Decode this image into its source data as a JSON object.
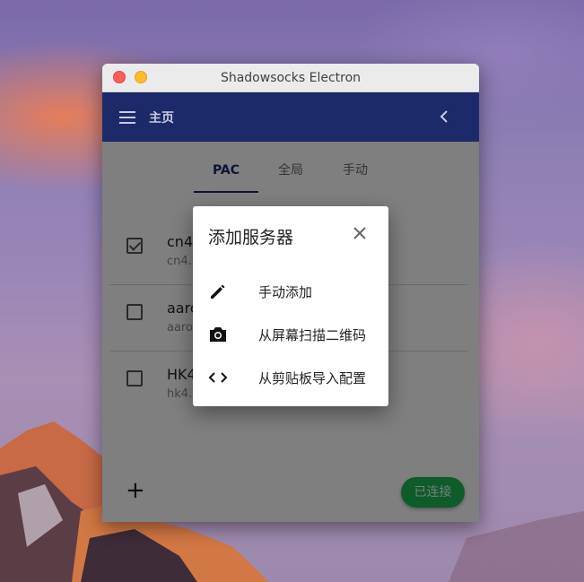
{
  "window": {
    "title": "Shadowsocks Electron"
  },
  "appbar": {
    "title": "主页",
    "menu_icon": "menu-icon",
    "back_icon": "chevron-left-icon"
  },
  "tabs": [
    {
      "label": "PAC",
      "active": true
    },
    {
      "label": "全局",
      "active": false
    },
    {
      "label": "手动",
      "active": false
    }
  ],
  "servers": [
    {
      "name": "cn4.",
      "host": "cn4.r",
      "checked": true
    },
    {
      "name": "aaro",
      "host": "aaro",
      "checked": false
    },
    {
      "name": "HK4",
      "host": "hk4.r",
      "checked": false
    }
  ],
  "footer": {
    "add_label": "+",
    "connect_label": "已连接"
  },
  "dialog": {
    "title": "添加服务器",
    "close_icon": "close-icon",
    "items": [
      {
        "label": "手动添加",
        "icon": "pencil-icon"
      },
      {
        "label": "从屏幕扫描二维码",
        "icon": "camera-icon"
      },
      {
        "label": "从剪贴板导入配置",
        "icon": "code-icon"
      }
    ]
  },
  "colors": {
    "appbar": "#1c2a69",
    "connected": "#1db954"
  }
}
